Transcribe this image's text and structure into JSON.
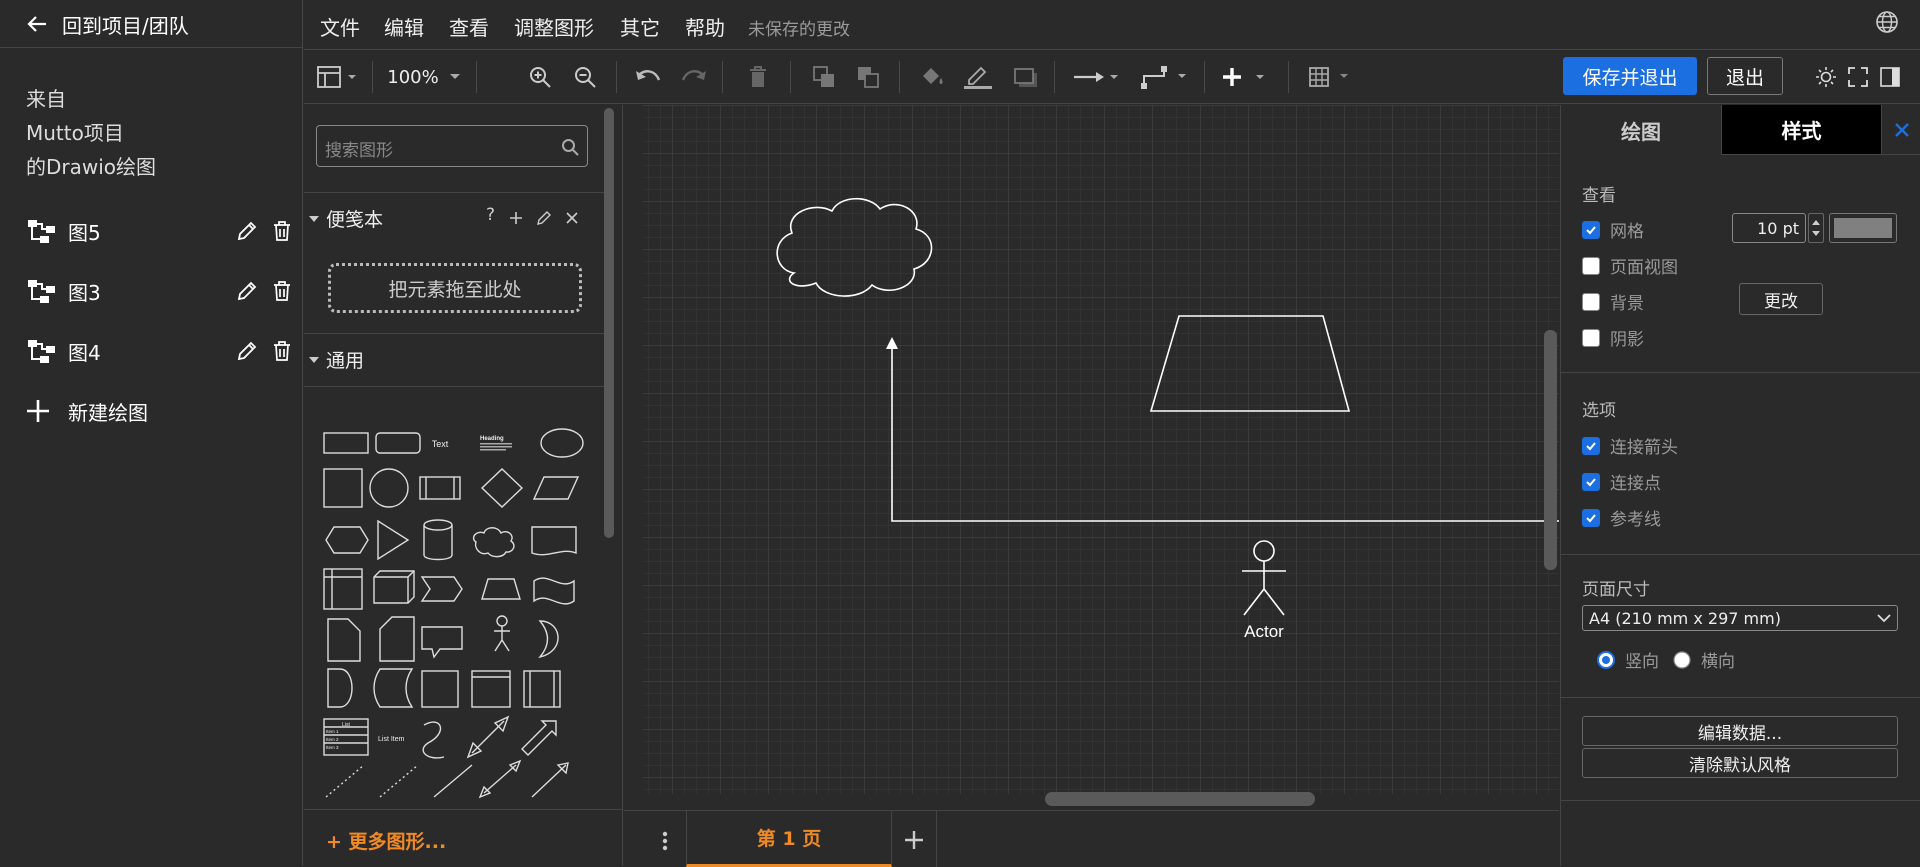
{
  "sidebar": {
    "back_label": "回到项目/团队",
    "source_lines": [
      "来自",
      "Mutto项目",
      "的Drawio绘图"
    ],
    "diagrams": [
      {
        "label": "图5"
      },
      {
        "label": "图3"
      },
      {
        "label": "图4"
      }
    ],
    "new_label": "新建绘图"
  },
  "menu": {
    "items": [
      "文件",
      "编辑",
      "查看",
      "调整图形",
      "其它",
      "帮助"
    ],
    "unsaved": "未保存的更改"
  },
  "toolbar": {
    "zoom": "100%",
    "save_exit": "保存并退出",
    "exit": "退出"
  },
  "shapes": {
    "search_placeholder": "搜索图形",
    "scratchpad": "便笺本",
    "scratchpad_help": "?",
    "drop_hint": "把元素拖至此处",
    "general": "通用",
    "text_label": "Text",
    "heading_label": "Heading",
    "list_label": "List",
    "list_item_label": "List Item",
    "item_labels": [
      "Item 1",
      "Item 2",
      "Item 3"
    ],
    "more": "+ 更多图形..."
  },
  "canvas": {
    "actor_label": "Actor"
  },
  "pages": {
    "current": "第 1 页"
  },
  "format": {
    "tab_diagram": "绘图",
    "tab_style": "样式",
    "view_heading": "查看",
    "grid_label": "网格",
    "grid_size": "10 pt",
    "page_view_label": "页面视图",
    "background_label": "背景",
    "change_button": "更改",
    "shadow_label": "阴影",
    "options_heading": "选项",
    "connection_arrows": "连接箭头",
    "connection_points": "连接点",
    "guides": "参考线",
    "page_size_heading": "页面尺寸",
    "page_size": "A4 (210 mm x 297 mm)",
    "portrait": "竖向",
    "landscape": "横向",
    "edit_data": "编辑数据...",
    "clear_style": "清除默认风格",
    "grid_color": "#808080",
    "accent": "#1c6fe0",
    "tab_accent": "#f08a24"
  }
}
